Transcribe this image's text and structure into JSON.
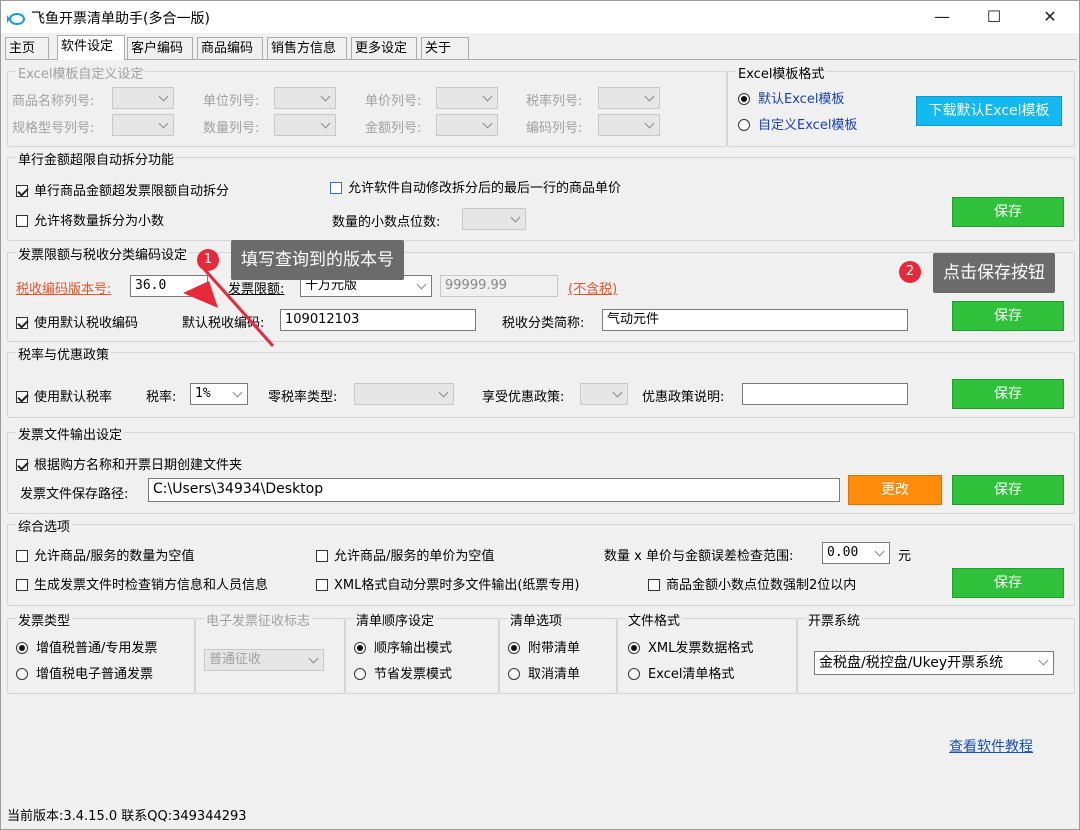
{
  "window": {
    "title": "飞鱼开票清单助手(多合一版)",
    "minimize": "—",
    "maximize": "☐",
    "close": "✕"
  },
  "tabs": [
    "主页",
    "软件设定",
    "客户编码",
    "商品编码",
    "销售方信息",
    "更多设定",
    "关于"
  ],
  "excel_custom": {
    "title": "Excel模板自定义设定",
    "labels": [
      "商品名称列号:",
      "单位列号:",
      "单价列号:",
      "税率列号:",
      "规格型号列号:",
      "数量列号:",
      "金额列号:",
      "编码列号:"
    ]
  },
  "excel_format": {
    "title": "Excel模板格式",
    "option_default": "默认Excel模板",
    "option_custom": "自定义Excel模板",
    "download_button": "下载默认Excel模板"
  },
  "split": {
    "title": "单行金额超限自动拆分功能",
    "auto_split": "单行商品金额超发票限额自动拆分",
    "allow_modify_price": "允许软件自动修改拆分后的最后一行的商品单价",
    "allow_decimal_qty": "允许将数量拆分为小数",
    "decimal_places_label": "数量的小数点位数:",
    "save": "保存"
  },
  "invoice_limit": {
    "title": "发票限额与税收分类编码设定",
    "version_label": "税收编码版本号:",
    "version_value": "36.0",
    "limit_label": "发票限额:",
    "limit_select": "十万元版",
    "limit_amount": "99999.99",
    "tax_excluded": "(不含税)",
    "use_default_code": "使用默认税收编码",
    "default_code_label": "默认税收编码:",
    "default_code_value": "109012103",
    "short_name_label": "税收分类简称:",
    "short_name_value": "气动元件",
    "save": "保存"
  },
  "tax_rate": {
    "title": "税率与优惠政策",
    "use_default_rate": "使用默认税率",
    "rate_label": "税率:",
    "rate_value": "1%",
    "zero_rate_label": "零税率类型:",
    "preferential_label": "享受优惠政策:",
    "policy_desc_label": "优惠政策说明:",
    "save": "保存"
  },
  "output": {
    "title": "发票文件输出设定",
    "create_folder": "根据购方名称和开票日期创建文件夹",
    "path_label": "发票文件保存路径:",
    "path_value": "C:\\Users\\34934\\Desktop",
    "change": "更改",
    "save": "保存"
  },
  "misc": {
    "title": "综合选项",
    "allow_empty_qty": "允许商品/服务的数量为空值",
    "allow_empty_price": "允许商品/服务的单价为空值",
    "error_range_label": "数量 x 单价与金额误差检查范围:",
    "error_range_value": "0.00",
    "unit": "元",
    "check_seller": "生成发票文件时检查销方信息和人员信息",
    "xml_split": "XML格式自动分票时多文件输出(纸票专用)",
    "force_2_decimals": "商品金额小数点位数强制2位以内",
    "save": "保存"
  },
  "invoice_type": {
    "title": "发票类型",
    "opt1": "增值税普通/专用发票",
    "opt2": "增值税电子普通发票"
  },
  "e_invoice": {
    "title": "电子发票征收标志",
    "value": "普通征收"
  },
  "list_order": {
    "title": "清单顺序设定",
    "opt1": "顺序输出模式",
    "opt2": "节省发票模式"
  },
  "list_option": {
    "title": "清单选项",
    "opt1": "附带清单",
    "opt2": "取消清单"
  },
  "file_format": {
    "title": "文件格式",
    "opt1": "XML发票数据格式",
    "opt2": "Excel清单格式"
  },
  "invoice_system": {
    "title": "开票系统",
    "value": "金税盘/税控盘/Ukey开票系统"
  },
  "tutorial_link": "查看软件教程",
  "status": "当前版本:3.4.15.0   联系QQ:349344293",
  "annotations": {
    "badge1": "1",
    "callout1": "填写查询到的版本号",
    "badge2": "2",
    "callout2": "点击保存按钮"
  }
}
